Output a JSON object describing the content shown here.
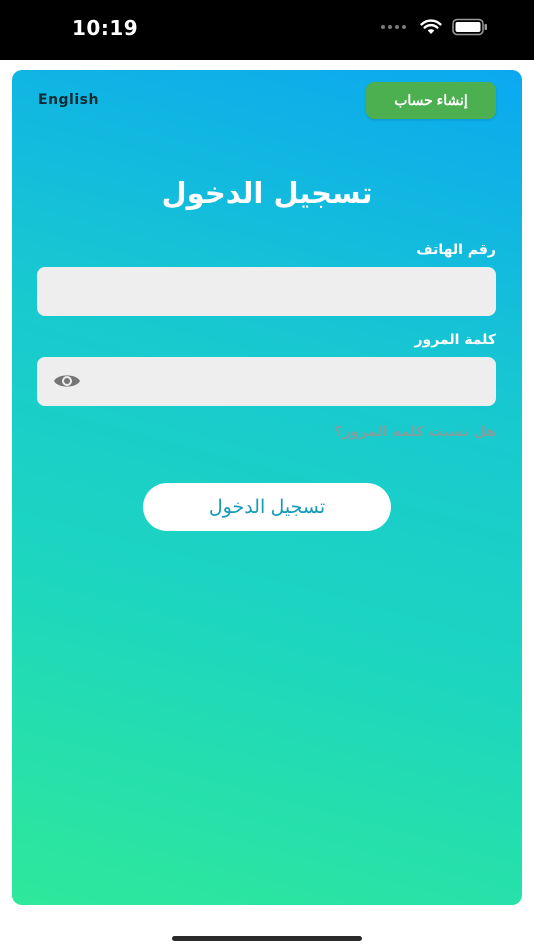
{
  "status_bar": {
    "time": "10:19"
  },
  "header": {
    "language_toggle": "English",
    "signup_button": "إنشاء حساب"
  },
  "login": {
    "title": "تسجيل الدخول",
    "phone_label": "رقم الهاتف",
    "phone_value": "",
    "password_label": "كلمة المرور",
    "password_value": "",
    "forgot_password": "هل نسيت كلمة المرور؟",
    "submit_button": "تسجيل الدخول"
  },
  "colors": {
    "gradient_top": "#0ba8f0",
    "gradient_bottom": "#2ee89a",
    "signup_green": "#4caf50",
    "input_bg": "#eeeeee",
    "button_text": "#159bb8"
  },
  "icons": {
    "password_toggle": "eye-icon",
    "wifi": "wifi-icon",
    "battery": "battery-icon",
    "signal": "cellular-signal-icon"
  }
}
